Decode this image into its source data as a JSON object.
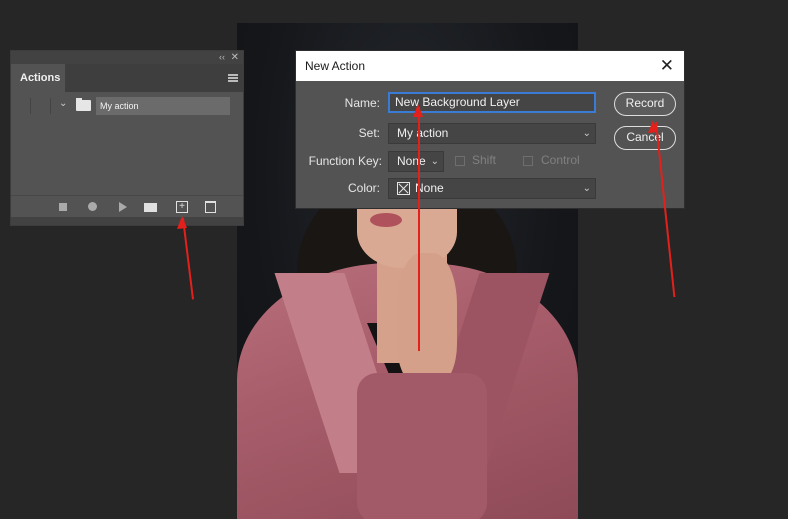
{
  "actions_panel": {
    "tab_label": "Actions",
    "collapse_glyph": "‹‹",
    "close_glyph": "✕",
    "action_set_name": "My action",
    "toolbar": [
      "stop-icon",
      "record-icon",
      "play-icon",
      "folder-icon",
      "new-action-icon",
      "trash-icon"
    ]
  },
  "dialog": {
    "title": "New Action",
    "close_glyph": "✕",
    "name_label": "Name:",
    "name_value": "New Background Layer",
    "set_label": "Set:",
    "set_value": "My action",
    "function_key_label": "Function Key:",
    "function_key_value": "None",
    "shift_label": "Shift",
    "control_label": "Control",
    "color_label": "Color:",
    "color_value": "None",
    "record_button": "Record",
    "cancel_button": "Cancel"
  },
  "colors": {
    "annotation_arrow": "#e3201b",
    "focus_border": "#3a7bd5"
  }
}
